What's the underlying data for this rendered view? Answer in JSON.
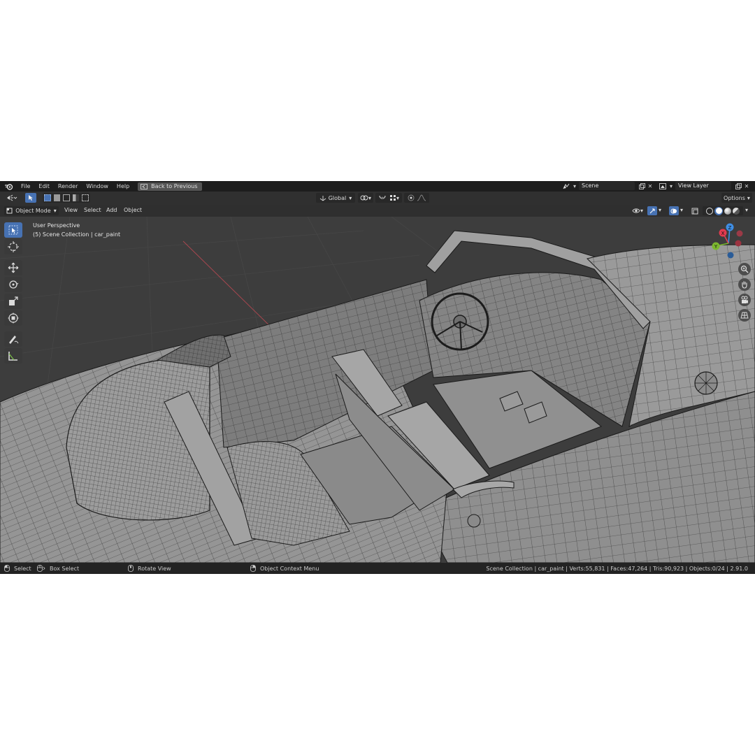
{
  "menu": {
    "items": [
      "File",
      "Edit",
      "Render",
      "Window",
      "Help"
    ],
    "back_button": "Back to Previous"
  },
  "scene": {
    "name": "Scene"
  },
  "view_layer": {
    "name": "View Layer"
  },
  "tool_header": {
    "transform_orientation": "Global",
    "options_label": "Options"
  },
  "viewport_header": {
    "mode": "Object Mode",
    "menus": [
      "View",
      "Select",
      "Add",
      "Object"
    ]
  },
  "viewport": {
    "perspective": "User Perspective",
    "collection_info": "(5) Scene Collection | car_paint"
  },
  "gizmo": {
    "x": "X",
    "y": "Y",
    "z": "Z"
  },
  "status_bar": {
    "select": "Select",
    "box_select": "Box Select",
    "rotate_view": "Rotate View",
    "context_menu": "Object Context Menu",
    "stats": "Scene Collection | car_paint | Verts:55,831 | Faces:47,264 | Tris:90,923 | Objects:0/24 | 2.91.0"
  },
  "colors": {
    "accent": "#4772b3",
    "axis_x": "#e33b4f",
    "axis_y": "#7cb82f",
    "axis_z": "#3f8fe6",
    "wire": "#1a1a1a",
    "surface": "#9a9a9a"
  }
}
